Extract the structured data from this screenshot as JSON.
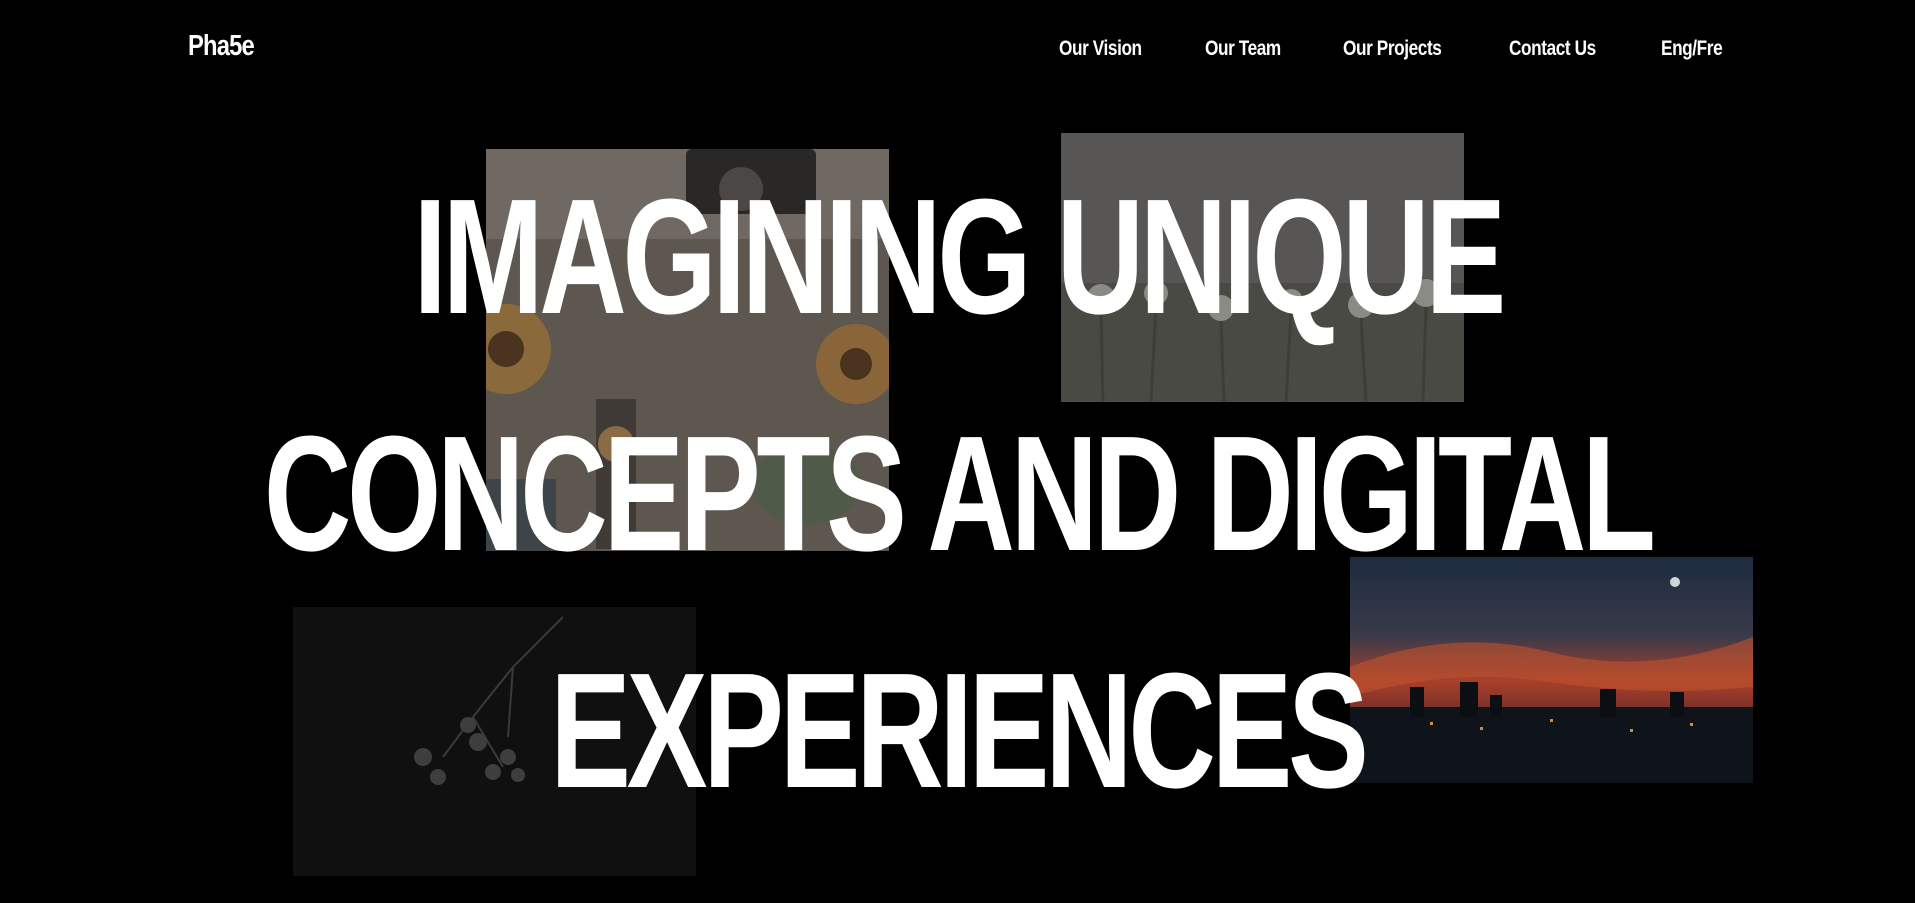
{
  "header": {
    "logo": "Pha5e"
  },
  "nav": {
    "items": [
      {
        "label": "Our Vision"
      },
      {
        "label": "Our Team"
      },
      {
        "label": "Our Projects"
      },
      {
        "label": "Contact Us"
      },
      {
        "label": "Eng/Fre"
      }
    ]
  },
  "hero": {
    "lines": [
      "IMAGINING UNIQUE",
      "CONCEPTS AND DIGITAL",
      "EXPERIENCES"
    ]
  },
  "colors": {
    "background": "#000000",
    "text": "#ffffff"
  }
}
